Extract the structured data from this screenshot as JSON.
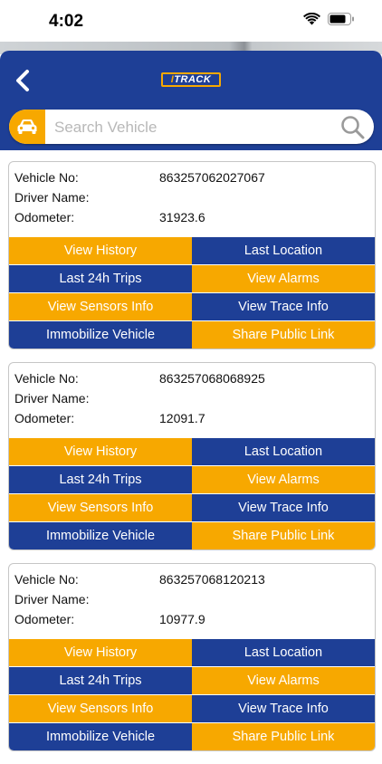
{
  "status": {
    "time": "4:02"
  },
  "header": {
    "logo_prefix": "I",
    "logo_text": "TRACK"
  },
  "search": {
    "placeholder": "Search Vehicle",
    "value": ""
  },
  "labels": {
    "vehicle_no": "Vehicle No:",
    "driver_name": "Driver Name:",
    "odometer": "Odometer:"
  },
  "actions": {
    "view_history": "View History",
    "last_location": "Last Location",
    "last_24h_trips": "Last 24h Trips",
    "view_alarms": "View Alarms",
    "view_sensors_info": "View Sensors Info",
    "view_trace_info": "View Trace Info",
    "immobilize_vehicle": "Immobilize Vehicle",
    "share_public_link": "Share Public Link"
  },
  "vehicles": [
    {
      "vehicle_no": "863257062027067",
      "driver_name": "",
      "odometer": "31923.6"
    },
    {
      "vehicle_no": "863257068068925",
      "driver_name": "",
      "odometer": "12091.7"
    },
    {
      "vehicle_no": "863257068120213",
      "driver_name": "",
      "odometer": "10977.9"
    }
  ],
  "colors": {
    "brand_blue": "#1e3f96",
    "accent_orange": "#f7a800"
  }
}
